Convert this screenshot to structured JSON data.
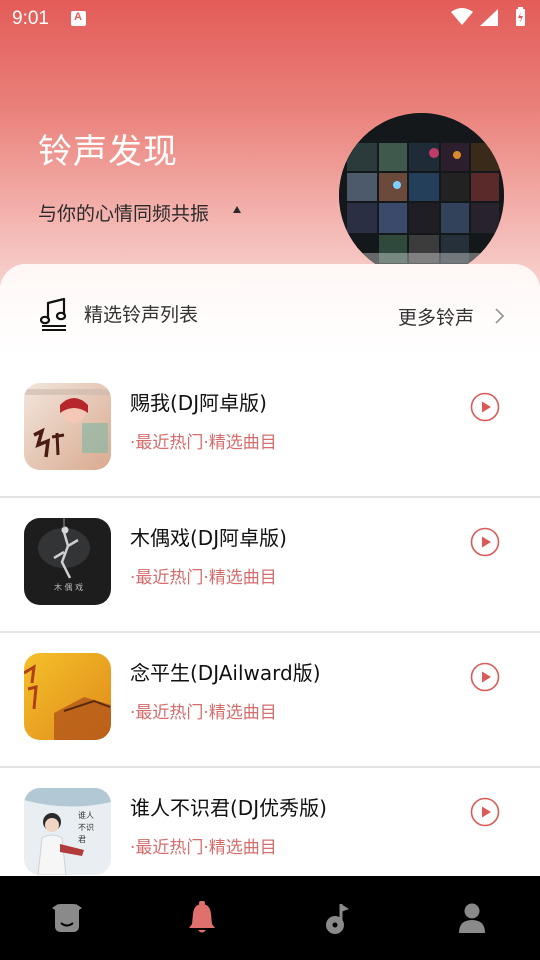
{
  "status_bar": {
    "time": "9:01",
    "icons": [
      "notification-a-icon",
      "wifi-icon",
      "signal-icon",
      "battery-charging-icon"
    ]
  },
  "header": {
    "title": "铃声发现",
    "subtitle": "与你的心情同频共振",
    "colors": {
      "gradient_top": "#e35c58",
      "gradient_bottom": "#f8d8d5"
    }
  },
  "section": {
    "icon": "music-note-icon",
    "title": "精选铃声列表",
    "more_label": "更多铃声"
  },
  "songs": [
    {
      "title": "赐我(DJ阿卓版)",
      "tags": "·最近热门·精选曲目"
    },
    {
      "title": "木偶戏(DJ阿卓版)",
      "tags": "·最近热门·精选曲目"
    },
    {
      "title": "念平生(DJAilward版)",
      "tags": "·最近热门·精选曲目"
    },
    {
      "title": "谁人不识君(DJ优秀版)",
      "tags": "·最近热门·精选曲目"
    }
  ],
  "tab_bar": {
    "tabs": [
      {
        "icon": "home-face-icon",
        "active": false
      },
      {
        "icon": "bell-icon",
        "active": true
      },
      {
        "icon": "music-icon",
        "active": false
      },
      {
        "icon": "profile-icon",
        "active": false
      }
    ],
    "colors": {
      "active": "#e0706b",
      "inactive": "#8a8a8a",
      "background": "#000000"
    }
  },
  "colors": {
    "accent": "#d95b57",
    "tag_text": "#d56d6d"
  }
}
